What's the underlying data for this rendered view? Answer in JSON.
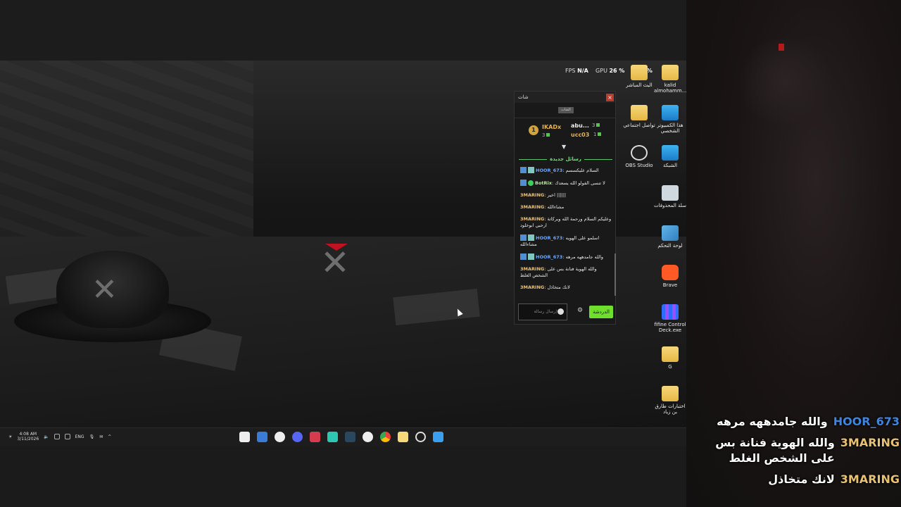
{
  "hud": {
    "fps_label": "FPS",
    "fps_value": "N/A",
    "gpu_label": "GPU",
    "gpu_value": "26 %",
    "cpu_label": "CP",
    "cpu_value": "1 %"
  },
  "desktop_icons": [
    {
      "label": "kalid almohamm...",
      "icon": "folder-icon"
    },
    {
      "label": "البث المباشر",
      "icon": "folder-icon"
    },
    {
      "label": "هذا الكمبيوتر الشخصي",
      "icon": "monitor-icon"
    },
    {
      "label": "تواصل اجتماعي",
      "icon": "folder-icon"
    },
    {
      "label": "الشبكة",
      "icon": "network-icon"
    },
    {
      "label": "OBS Studio",
      "icon": "obs-icon"
    },
    {
      "label": "سلة المحذوفات",
      "icon": "recycle-bin-icon"
    },
    {
      "label": "لوحة التحكم",
      "icon": "control-panel-icon"
    },
    {
      "label": "Brave",
      "icon": "brave-icon"
    },
    {
      "label": "fifine Control Deck.exe",
      "icon": "control-deck-icon"
    },
    {
      "label": "G",
      "icon": "folder-icon"
    },
    {
      "label": "اختبارات طارق بن زياد",
      "icon": "folder-icon"
    }
  ],
  "chat": {
    "title": "شات",
    "close": "×",
    "tab": "الشات",
    "leaderboard": [
      {
        "rank": "1",
        "name": "IKADx",
        "count": "3"
      },
      {
        "name": "abu...",
        "count": "3"
      },
      {
        "name": "ucc03",
        "count": "1"
      }
    ],
    "new_messages_label": "رسائل جديدة",
    "messages": [
      {
        "user": "HOOR_673",
        "text": "السلام عليكسسم",
        "badges": true,
        "color": "blue"
      },
      {
        "user": "BotRix",
        "text": "لا تنسى الفولو الله يسعدك",
        "badges": true,
        "verified": true,
        "color": "bot"
      },
      {
        "user": "3MARING",
        "text": "اخير ||||||",
        "color": "gold"
      },
      {
        "user": "3MARING",
        "text": "مشاءالله",
        "color": "gold"
      },
      {
        "user": "3MARING",
        "text": "وعليكم السلام ورحمة الله وبركاتة ارحبي ابوخلود",
        "color": "gold"
      },
      {
        "user": "HOOR_673",
        "text": "اسلمو على الهويه مشاءالله",
        "badges": true,
        "color": "blue"
      },
      {
        "user": "HOOR_673",
        "text": "والله جامدههه مرهه",
        "badges": true,
        "color": "blue"
      },
      {
        "user": "3MARING",
        "text": "والله الهوية فنانة بس على الشخص الغلط",
        "color": "gold"
      },
      {
        "user": "3MARING",
        "text": "لانك متخاذل",
        "color": "gold"
      }
    ],
    "input_placeholder": "إرسال رسالة",
    "send_label": "الدردشة"
  },
  "taskbar": {
    "time": "4:08 AM",
    "date": "3/11/2026",
    "language": "ENG"
  },
  "overlay": [
    {
      "user": "HOOR_673",
      "text": "والله جامدههه مرهه",
      "color": "#3c86e0"
    },
    {
      "user": "3MARING",
      "text": "والله الهوية فنانة بس على الشخص الغلط",
      "color": "#e8c271"
    },
    {
      "user": "3MARING",
      "text": "لانك متخاذل",
      "color": "#e8c271"
    }
  ]
}
